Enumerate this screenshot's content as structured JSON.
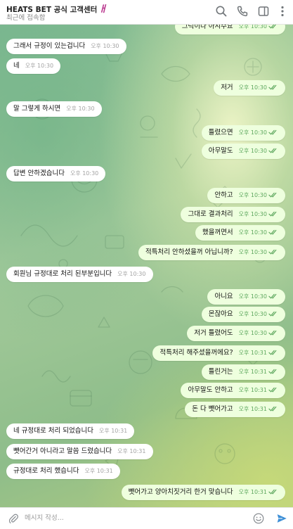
{
  "header": {
    "title": "HEATS BET 공식 고객센터",
    "title_deco": "ㅐ",
    "status": "최근에 접속함",
    "icons": [
      "search-icon",
      "phone-icon",
      "sidebar-icon",
      "more-icon"
    ]
  },
  "messages": [
    {
      "dir": "out",
      "text": "그럭이다 아시주요",
      "time": "오후 10:30",
      "read": true
    },
    {
      "dir": "in",
      "text": "그래서 규정이 있는겁니다",
      "time": "오후 10:30"
    },
    {
      "dir": "in",
      "text": "네",
      "time": "오후 10:30"
    },
    {
      "dir": "out",
      "text": "저거",
      "time": "오후 10:30",
      "read": true
    },
    {
      "dir": "in",
      "text": "말 그렇게 하시면",
      "time": "오후 10:30"
    },
    {
      "dir": "out",
      "text": "틀렸으면",
      "time": "오후 10:30",
      "read": true
    },
    {
      "dir": "out",
      "text": "아무말도",
      "time": "오후 10:30",
      "read": true
    },
    {
      "dir": "in",
      "text": "답변 안하겠습니다",
      "time": "오후 10:30"
    },
    {
      "dir": "out",
      "text": "안하고",
      "time": "오후 10:30",
      "read": true
    },
    {
      "dir": "out",
      "text": "그대로 결과처리",
      "time": "오후 10:30",
      "read": true
    },
    {
      "dir": "out",
      "text": "했을꺼면서",
      "time": "오후 10:30",
      "read": true
    },
    {
      "dir": "out",
      "text": "적특처리 안하셨을꺼 아닙니까?",
      "time": "오후 10:30",
      "read": true
    },
    {
      "dir": "in",
      "text": "회원님 규정대로 처리 된부분입니다",
      "time": "오후 10:30"
    },
    {
      "dir": "out",
      "text": "아니요",
      "time": "오후 10:30",
      "read": true
    },
    {
      "dir": "out",
      "text": "몬잖아요",
      "time": "오후 10:30",
      "read": true
    },
    {
      "dir": "out",
      "text": "저거 틀렸어도",
      "time": "오후 10:30",
      "read": true
    },
    {
      "dir": "out",
      "text": "적특처리 해주셨을꺼에요?",
      "time": "오후 10:31",
      "read": true
    },
    {
      "dir": "out",
      "text": "틀린거는",
      "time": "오후 10:31",
      "read": true
    },
    {
      "dir": "out",
      "text": "아무말도 안하고",
      "time": "오후 10:31",
      "read": true
    },
    {
      "dir": "out",
      "text": "돈 다 뺏어가고",
      "time": "오후 10:31",
      "read": true
    },
    {
      "dir": "in",
      "text": "네 규정대로 처리 되었습니다",
      "time": "오후 10:31"
    },
    {
      "dir": "in",
      "text": "뺏어간거 아니라고 말씀 드렸습니다",
      "time": "오후 10:31"
    },
    {
      "dir": "in",
      "text": "규정대로 처리 했습니다",
      "time": "오후 10:31"
    },
    {
      "dir": "out",
      "text": "뺏어가고 양아치짓거리 한거 맞습니다",
      "time": "오후 10:31",
      "read": true
    }
  ],
  "composer": {
    "placeholder": "메시지 작성...",
    "icons": [
      "attach-icon",
      "emoji-icon",
      "send-icon"
    ]
  },
  "colors": {
    "outgoing_bubble": "#eeffde",
    "incoming_bubble": "#ffffff",
    "check": "#5fa85f",
    "send": "#3d8fd6",
    "title_deco": "#b8338c"
  }
}
